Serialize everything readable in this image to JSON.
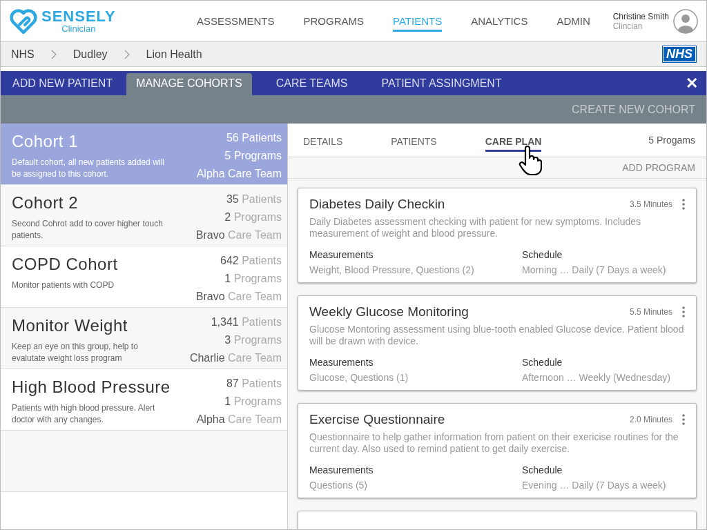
{
  "brand": {
    "name": "SENSELY",
    "subtitle": "Clinician"
  },
  "nav": [
    {
      "label": "ASSESSMENTS",
      "selected": false
    },
    {
      "label": "PROGRAMS",
      "selected": false
    },
    {
      "label": "PATIENTS",
      "selected": true
    },
    {
      "label": "ANALYTICS",
      "selected": false
    },
    {
      "label": "ADMIN",
      "selected": false
    }
  ],
  "user": {
    "name": "Christine Smith",
    "role": "Clincian"
  },
  "breadcrumb": [
    "NHS",
    "Dudley",
    "Lion Health"
  ],
  "org_badge": "NHS",
  "sub_tabs": [
    {
      "label": "ADD NEW PATIENT",
      "selected": false
    },
    {
      "label": "MANAGE COHORTS",
      "selected": true
    },
    {
      "label": "CARE TEAMS",
      "selected": false
    },
    {
      "label": "PATIENT ASSINGMENT",
      "selected": false
    }
  ],
  "close_label": "✕",
  "create_action": "CREATE NEW COHORT",
  "cohorts": [
    {
      "name": "Cohort 1",
      "description": "Default cohort, all new patients added will be assigned to this cohort.",
      "patients_count": "56",
      "patients_label": "Patients",
      "programs_count": "5",
      "programs_label": "Programs",
      "team": "Alpha",
      "team_label": "Care Team",
      "selected": true
    },
    {
      "name": "Cohort 2",
      "description": "Second Cohrot add to cover higher touch patients.",
      "patients_count": "35",
      "patients_label": "Patients",
      "programs_count": "2",
      "programs_label": "Programs",
      "team": "Bravo",
      "team_label": "Care Team",
      "selected": false
    },
    {
      "name": "COPD Cohort",
      "description": "Monitor patients with COPD",
      "patients_count": "642",
      "patients_label": "Patients",
      "programs_count": "1",
      "programs_label": "Programs",
      "team": "Bravo",
      "team_label": "Care Team",
      "selected": false
    },
    {
      "name": "Monitor Weight",
      "description": "Keep an eye on this group, help to evalutate weight loss program",
      "patients_count": "1,341",
      "patients_label": "Patients",
      "programs_count": "3",
      "programs_label": "Programs",
      "team": "Charlie",
      "team_label": "Care Team",
      "selected": false
    },
    {
      "name": "High Blood Pressure",
      "description": "Patients with high blood pressure.  Alert doctor with any changes.",
      "patients_count": "87",
      "patients_label": "Patients",
      "programs_count": "1",
      "programs_label": "Programs",
      "team": "Alpha",
      "team_label": "Care Team",
      "selected": false
    }
  ],
  "detail_tabs": [
    {
      "label": "DETAILS",
      "selected": false
    },
    {
      "label": "PATIENTS",
      "selected": false
    },
    {
      "label": "CARE PLAN",
      "selected": true
    }
  ],
  "program_count": "5 Progams",
  "add_action": "ADD PROGRAM",
  "programs": [
    {
      "title": "Diabetes Daily Checkin",
      "duration": "3.5 Minutes",
      "description": "Daily Diabetes assessment checking with patient for new symptoms.  Includes measurement of weight and blood pressure.",
      "measurements_label": "Measurements",
      "measurements": "Weight, Blood Pressure, Questions (2)",
      "schedule_label": "Schedule",
      "schedule": "Morning … Daily (7 Days a week)"
    },
    {
      "title": "Weekly Glucose Monitoring",
      "duration": "5.5 Minutes",
      "description": "Glucose Montoring assessment using blue-tooth enabled Glucose device.  Patient blood will be drawn with device.",
      "measurements_label": "Measurements",
      "measurements": "Glucose, Questions (1)",
      "schedule_label": "Schedule",
      "schedule": "Afternoon … Weekly (Wednesday)"
    },
    {
      "title": "Exercise Questionnaire",
      "duration": "2.0 Minutes",
      "description": "Questionnaire to help gather information from patient on their exericise routines for the current day.  Also used to remind patient to get daily exercise.",
      "measurements_label": "Measurements",
      "measurements": "Questions (5)",
      "schedule_label": "Schedule",
      "schedule": "Evening … Daily (7 Days a week)"
    }
  ]
}
